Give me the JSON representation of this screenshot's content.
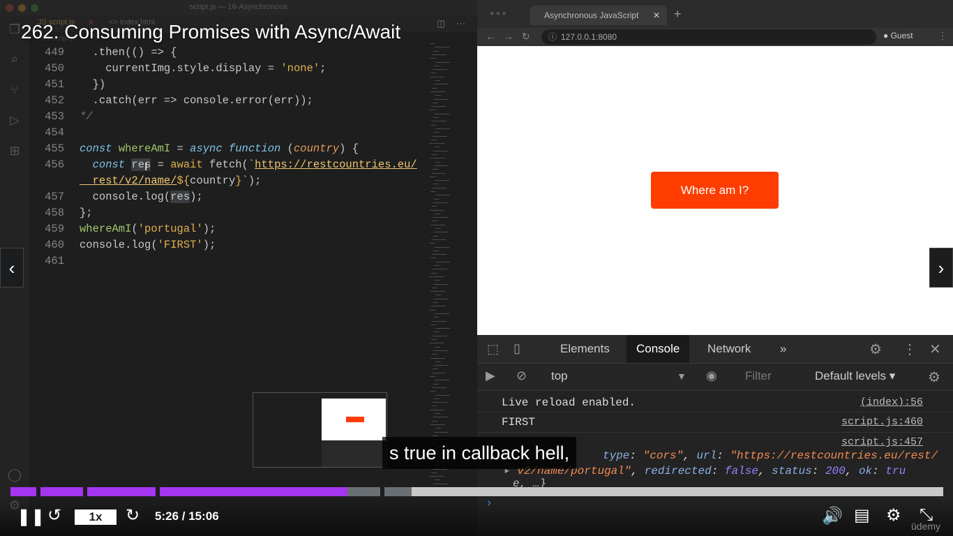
{
  "video": {
    "title": "262. Consuming Promises with Async/Await",
    "caption": "s true in callback hell,",
    "speed": "1x",
    "time": "5:26 / 15:06",
    "progress_played_fraction": 0.361,
    "progress_buffered_fraction": 0.43,
    "brand": "ūdemy"
  },
  "editor": {
    "window_title": "script.js — 16-Asynchronous",
    "tabs": [
      {
        "label": "JS script.js"
      },
      {
        "label": "<> index.html"
      }
    ],
    "breadcrumb": "JS script.js",
    "lines": [
      {
        "n": "449",
        "tokens": [
          [
            "txt",
            "  .then(() => {"
          ]
        ]
      },
      {
        "n": "450",
        "tokens": [
          [
            "txt",
            "    currentImg.style.display = "
          ],
          [
            "str",
            "'none'"
          ],
          [
            "txt",
            ";"
          ]
        ]
      },
      {
        "n": "451",
        "tokens": [
          [
            "txt",
            "  })"
          ]
        ]
      },
      {
        "n": "452",
        "tokens": [
          [
            "txt",
            "  .catch(err => console.error(err));"
          ]
        ]
      },
      {
        "n": "453",
        "tokens": [
          [
            "cm",
            "*/"
          ]
        ]
      },
      {
        "n": "454",
        "tokens": []
      },
      {
        "n": "455",
        "tokens": [
          [
            "kw",
            "const "
          ],
          [
            "fn",
            "whereAmI"
          ],
          [
            "txt",
            " = "
          ],
          [
            "kw",
            "async function "
          ],
          [
            "txt",
            "("
          ],
          [
            "param",
            "country"
          ],
          [
            "txt",
            ") {"
          ]
        ]
      },
      {
        "n": "456",
        "tokens": [
          [
            "kw",
            "  const "
          ],
          [
            "hl",
            "res"
          ],
          [
            "txt",
            " = "
          ],
          [
            "str",
            "await "
          ],
          [
            "txt",
            "fetch(`"
          ],
          [
            "url",
            "https://restcountries.eu/"
          ]
        ]
      },
      {
        "n": "",
        "tokens": [
          [
            "url",
            "  rest/v2/name/"
          ],
          [
            "str",
            "${"
          ],
          [
            "txt",
            "country"
          ],
          [
            "str",
            "}"
          ],
          [
            "txt",
            "`);"
          ]
        ]
      },
      {
        "n": "457",
        "tokens": [
          [
            "txt",
            "  console.log("
          ],
          [
            "hl",
            "res"
          ],
          [
            "txt",
            ");"
          ]
        ]
      },
      {
        "n": "458",
        "tokens": [
          [
            "txt",
            "};"
          ]
        ]
      },
      {
        "n": "459",
        "tokens": [
          [
            "fn",
            "whereAmI"
          ],
          [
            "txt",
            "("
          ],
          [
            "str",
            "'portugal'"
          ],
          [
            "txt",
            ");"
          ]
        ]
      },
      {
        "n": "460",
        "tokens": [
          [
            "txt",
            "console.log("
          ],
          [
            "str",
            "'FIRST'"
          ],
          [
            "txt",
            ");"
          ]
        ]
      },
      {
        "n": "461",
        "tokens": []
      }
    ]
  },
  "browser": {
    "tab_title": "Asynchronous JavaScript",
    "url": "127.0.0.1:8080",
    "profile": "Guest",
    "button_label": "Where am I?"
  },
  "devtools": {
    "tabs": [
      "Elements",
      "Console",
      "Network",
      "»"
    ],
    "active_tab": "Console",
    "context": "top",
    "filter_placeholder": "Filter",
    "levels": "Default levels ▾",
    "logs": [
      {
        "text": "Live reload enabled.",
        "source": "(index):56"
      },
      {
        "text": "FIRST",
        "source": "script.js:460"
      },
      {
        "text": "",
        "source": "script.js:457"
      }
    ],
    "response_line1_key": "type",
    "response_line1_type": "\"cors\"",
    "response_line1_url": "\"https://restcountries.eu/rest/",
    "response_line2_url": "v2/name/portugal\"",
    "response_redirected": "false",
    "response_status": "200",
    "response_ok": "tru",
    "response_line3": "e, …}",
    "prompt": "›"
  },
  "colors": {
    "accent_button": "#ff3d00",
    "progress_played": "#a435f0",
    "progress_buffered": "#6a6f73",
    "progress_track": "#c9c9c9"
  }
}
